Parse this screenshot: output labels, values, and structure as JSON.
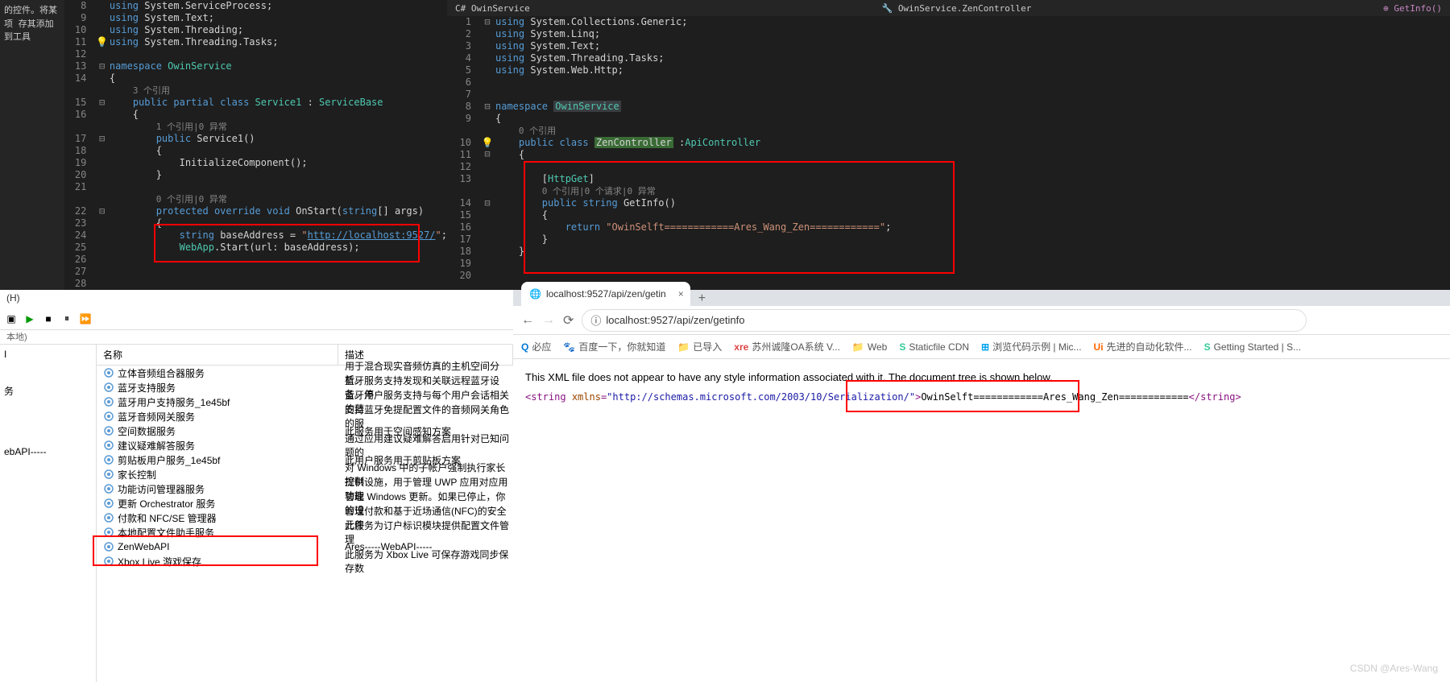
{
  "sidebar_tip": "的控件。将某项\n存其添加到工具",
  "left_editor": {
    "lines": [
      8,
      9,
      10,
      11,
      12,
      13,
      14,
      15,
      16,
      17,
      18,
      19,
      20,
      21,
      22,
      23,
      24,
      25,
      26,
      27,
      28
    ],
    "code": {
      "l8": "using System.ServiceProcess;",
      "l9": "using System.Text;",
      "l10": "using System.Threading;",
      "l11": "using System.Threading.Tasks;",
      "l13": "namespace OwinService",
      "l14": "{",
      "ref1": "3 个引用",
      "l15": "public partial class Service1 : ServiceBase",
      "l16": "{",
      "ref2": "1 个引用|0 异常",
      "l17": "public Service1()",
      "l18": "{",
      "l19": "InitializeComponent();",
      "l20": "}",
      "ref3": "0 个引用|0 异常",
      "l22": "protected override void OnStart(string[] args)",
      "l23": "{",
      "l24a": "string baseAddress = \"",
      "l24b": "http://localhost:9527/",
      "l24c": "\";",
      "l25": "WebApp.Start(url: baseAddress);"
    }
  },
  "right_editor": {
    "breadcrumb": {
      "project": "OwinService",
      "class": "OwinService.ZenController",
      "method": "GetInfo()"
    },
    "lines": [
      1,
      2,
      3,
      4,
      5,
      6,
      7,
      8,
      9,
      10,
      11,
      12,
      13,
      14,
      15,
      16,
      17,
      18,
      19,
      20
    ],
    "code": {
      "l1": "using System.Collections.Generic;",
      "l2": "using System.Linq;",
      "l3": "using System.Text;",
      "l4": "using System.Threading.Tasks;",
      "l5": "using System.Web.Http;",
      "l8": "namespace OwinService",
      "l9": "{",
      "ref1": "0 个引用",
      "l10a": "public class ",
      "l10b": "ZenController",
      "l10c": " :ApiController",
      "l11": "{",
      "l13": "[HttpGet]",
      "ref2": "0 个引用|0 个请求|0 异常",
      "l14": "public string GetInfo()",
      "l15": "{",
      "l16a": "return ",
      "l16b": "\"OwinSelft============Ares_Wang_Zen============\"",
      "l16c": ";",
      "l17": "}",
      "l18": "}"
    }
  },
  "services": {
    "menu_h": "(H)",
    "tree_label": "本地)",
    "col_name": "名称",
    "col_desc": "描述",
    "rows": [
      {
        "name": "立体音频组合器服务",
        "desc": "用于混合现实音频仿真的主机空间分析。"
      },
      {
        "name": "蓝牙支持服务",
        "desc": "蓝牙服务支持发现和关联远程蓝牙设备。停"
      },
      {
        "name": "蓝牙用户支持服务_1e45bf",
        "desc": "蓝牙用户服务支持与每个用户会话相关的蓝"
      },
      {
        "name": "蓝牙音频网关服务",
        "desc": "支持蓝牙免提配置文件的音频网关角色的服"
      },
      {
        "name": "空间数据服务",
        "desc": "此服务用于空间感知方案"
      },
      {
        "name": "建议疑难解答服务",
        "desc": "通过应用建议疑难解答启用针对已知问题的"
      },
      {
        "name": "剪贴板用户服务_1e45bf",
        "desc": "此用户服务用于剪贴板方案"
      },
      {
        "name": "家长控制",
        "desc": "对 Windows 中的子帐户强制执行家长控制"
      },
      {
        "name": "功能访问管理器服务",
        "desc": "提供设施，用于管理 UWP 应用对应用功能"
      },
      {
        "name": "更新 Orchestrator 服务",
        "desc": "管理 Windows 更新。如果已停止，你的设"
      },
      {
        "name": "付款和 NFC/SE 管理器",
        "desc": "管理付款和基于近场通信(NFC)的安全元件"
      },
      {
        "name": "本地配置文件助手服务",
        "desc": "此服务为订户标识模块提供配置文件管理"
      },
      {
        "name": "ZenWebAPI",
        "desc": "Ares-----WebAPI-----"
      },
      {
        "name": "Xbox Live 游戏保存",
        "desc": "此服务为 Xbox Live 可保存游戏同步保存数"
      }
    ],
    "left_tree": [
      "I",
      "务",
      "ebAPI-----"
    ]
  },
  "browser": {
    "tab_title": "localhost:9527/api/zen/getin",
    "url_display": "localhost:9527/api/zen/getinfo",
    "bookmarks": [
      {
        "icon": "Q",
        "label": "必应",
        "color": "#0078d4"
      },
      {
        "icon": "🐾",
        "label": "百度一下，你就知道",
        "color": "#3385ff"
      },
      {
        "icon": "📁",
        "label": "已导入",
        "color": "#666"
      },
      {
        "icon": "xre",
        "label": "苏州诚隆OA系统 V...",
        "color": "#d44"
      },
      {
        "icon": "📁",
        "label": "Web",
        "color": "#666"
      },
      {
        "icon": "S",
        "label": "Staticfile CDN",
        "color": "#3c9"
      },
      {
        "icon": "⊞",
        "label": "浏览代码示例 | Mic...",
        "color": "#00a4ef"
      },
      {
        "icon": "Ui",
        "label": "先进的自动化软件...",
        "color": "#f60"
      },
      {
        "icon": "S",
        "label": "Getting Started | S...",
        "color": "#3c9"
      }
    ],
    "xml_msg": "This XML file does not appear to have any style information associated with it. The document tree is shown below.",
    "xml": {
      "open": "<string",
      "attr": "xmlns",
      "ns": "\"http://schemas.microsoft.com/2003/10/Serialization/\"",
      "content": "OwinSelft============Ares_Wang_Zen============",
      "close": "</string>"
    },
    "watermark": "CSDN @Ares-Wang"
  }
}
